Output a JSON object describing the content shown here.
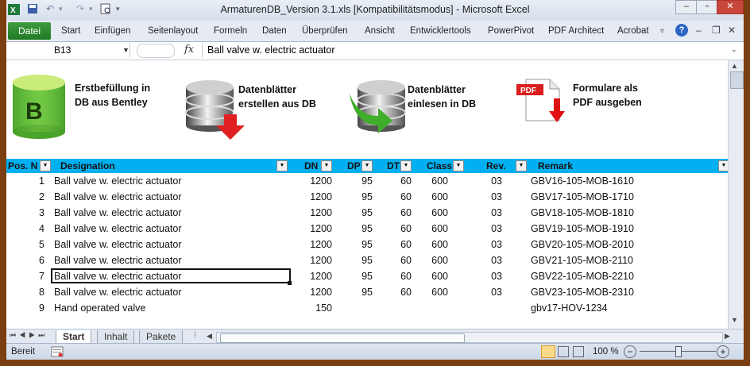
{
  "title_bar": {
    "app_title": "ArmaturenDB_Version 3.1.xls  [Kompatibilitätsmodus]  -  Microsoft Excel"
  },
  "ribbon": {
    "file_tab": "Datei",
    "tabs": [
      "Start",
      "Einfügen",
      "Seitenlayout",
      "Formeln",
      "Daten",
      "Überprüfen",
      "Ansicht",
      "Entwicklertools",
      "PowerPivot",
      "PDF Architect",
      "Acrobat"
    ]
  },
  "formula_bar": {
    "name_box": "B13",
    "fx": "fx",
    "content": "Ball valve w. electric actuator"
  },
  "toolbar": {
    "buttons": [
      {
        "line1": "Erstbefüllung in",
        "line2": "DB aus Bentley",
        "icon": "database-b-icon"
      },
      {
        "line1": "Datenblätter",
        "line2": "erstellen aus DB",
        "icon": "database-export-icon"
      },
      {
        "line1": "Datenblätter",
        "line2": "einlesen in DB",
        "icon": "database-import-icon"
      },
      {
        "line1": "Formulare als",
        "line2": "PDF ausgeben",
        "icon": "pdf-export-icon"
      }
    ],
    "db_letter": "B",
    "pdf_label": "PDF"
  },
  "table": {
    "headers": [
      "Pos. N",
      "Designation",
      "DN",
      "DP",
      "DT",
      "Class",
      "Rev.",
      "Remark"
    ],
    "rows": [
      [
        "1",
        "Ball valve w. electric actuator",
        "1200",
        "95",
        "60",
        "600",
        "03",
        "GBV16-105-MOB-1610"
      ],
      [
        "2",
        "Ball valve w. electric actuator",
        "1200",
        "95",
        "60",
        "600",
        "03",
        "GBV17-105-MOB-1710"
      ],
      [
        "3",
        "Ball valve w. electric actuator",
        "1200",
        "95",
        "60",
        "600",
        "03",
        "GBV18-105-MOB-1810"
      ],
      [
        "4",
        "Ball valve w. electric actuator",
        "1200",
        "95",
        "60",
        "600",
        "03",
        "GBV19-105-MOB-1910"
      ],
      [
        "5",
        "Ball valve w. electric actuator",
        "1200",
        "95",
        "60",
        "600",
        "03",
        "GBV20-105-MOB-2010"
      ],
      [
        "6",
        "Ball valve w. electric actuator",
        "1200",
        "95",
        "60",
        "600",
        "03",
        "GBV21-105-MOB-2110"
      ],
      [
        "7",
        "Ball valve w. electric actuator",
        "1200",
        "95",
        "60",
        "600",
        "03",
        "GBV22-105-MOB-2210"
      ],
      [
        "8",
        "Ball valve w. electric actuator",
        "1200",
        "95",
        "60",
        "600",
        "03",
        "GBV23-105-MOB-2310"
      ],
      [
        "9",
        "Hand operated valve",
        "150",
        "",
        "",
        "",
        "",
        "gbv17-HOV-1234"
      ]
    ]
  },
  "sheet_tabs": [
    "Start",
    "Inhalt",
    "Pakete"
  ],
  "status_bar": {
    "mode": "Bereit",
    "zoom": "100 %",
    "zoom_level_percent": 100
  },
  "colors": {
    "header_fill": "#00b0f0",
    "file_tab": "#1f7a24"
  }
}
